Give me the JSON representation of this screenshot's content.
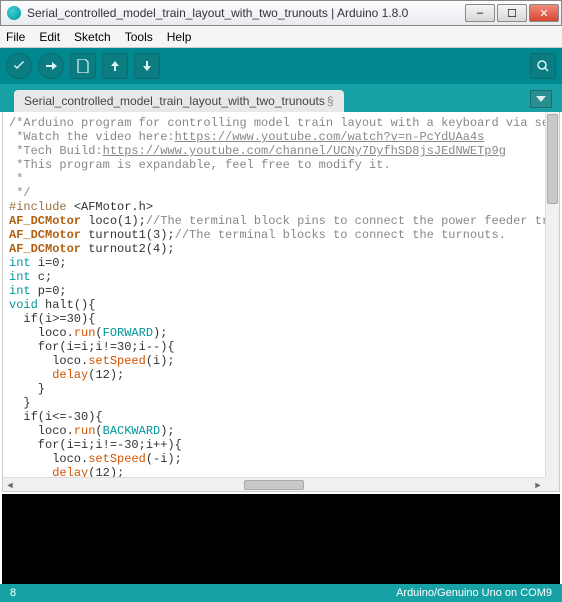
{
  "window": {
    "title": "Serial_controlled_model_train_layout_with_two_trunouts | Arduino 1.8.0",
    "min": "–",
    "max": "☐",
    "close": "✕"
  },
  "menu": {
    "file": "File",
    "edit": "Edit",
    "sketch": "Sketch",
    "tools": "Tools",
    "help": "Help"
  },
  "tab": {
    "name": "Serial_controlled_model_train_layout_with_two_trunouts",
    "suffix": "§"
  },
  "code": {
    "c1": "/*Arduino program for controlling model train layout with a keyboard via serial communicatic",
    "c2_a": " *Watch the video here:",
    "c2_link": "https://www.youtube.com/watch?v=n-PcYdUAa4s",
    "c3_a": " *Tech Build:",
    "c3_link": "https://www.youtube.com/channel/UCNy7DyfhSD8jsJEdNWETp9g",
    "c4": " *This program is expandable, feel free to modify it.",
    "c5": " *",
    "c6": " */",
    "inc_a": "#include ",
    "inc_b": "<AFMotor.h>",
    "l1_a": "AF_DCMotor",
    "l1_b": " loco(",
    "l1_n": "1",
    "l1_c": ");",
    "l1_cmt": "//The terminal block pins to connect the power feeder track.",
    "l2_a": "AF_DCMotor",
    "l2_b": " turnout1(",
    "l2_n": "3",
    "l2_c": ");",
    "l2_cmt": "//The terminal blocks to connect the turnouts.",
    "l3_a": "AF_DCMotor",
    "l3_b": " turnout2(",
    "l3_n": "4",
    "l3_c": ");",
    "l4_a": "int",
    "l4_b": " i=",
    "l4_n": "0",
    "l4_c": ";",
    "l5_a": "int",
    "l5_b": " c;",
    "l6_a": "int",
    "l6_b": " p=",
    "l6_n": "0",
    "l6_c": ";",
    "l7_a": "void",
    "l7_b": " halt(){",
    "l8": "  if(i>=30){",
    "l9_a": "    loco.",
    "l9_b": "run",
    "l9_c": "(",
    "l9_d": "FORWARD",
    "l9_e": ");",
    "l10": "    for(i=i;i!=30;i--){",
    "l11_a": "      loco.",
    "l11_b": "setSpeed",
    "l11_c": "(i);",
    "l12_a": "      ",
    "l12_b": "delay",
    "l12_c": "(",
    "l12_n": "12",
    "l12_d": ");",
    "l13": "    }",
    "l14": "  }",
    "l15": "  if(i<=-30){",
    "l16_a": "    loco.",
    "l16_b": "run",
    "l16_c": "(",
    "l16_d": "BACKWARD",
    "l16_e": ");",
    "l17": "    for(i=i;i!=-30;i++){",
    "l18_a": "      loco.",
    "l18_b": "setSpeed",
    "l18_c": "(-i);",
    "l19_a": "      ",
    "l19_b": "delay",
    "l19_c": "(",
    "l19_n": "12",
    "l19_d": ");"
  },
  "status": {
    "line": "8",
    "board": "Arduino/Genuino Uno on COM9"
  },
  "icons": {
    "verify": "verify-icon",
    "upload": "upload-icon",
    "new": "new-icon",
    "open": "open-icon",
    "save": "save-icon",
    "serial": "serial-monitor-icon"
  }
}
